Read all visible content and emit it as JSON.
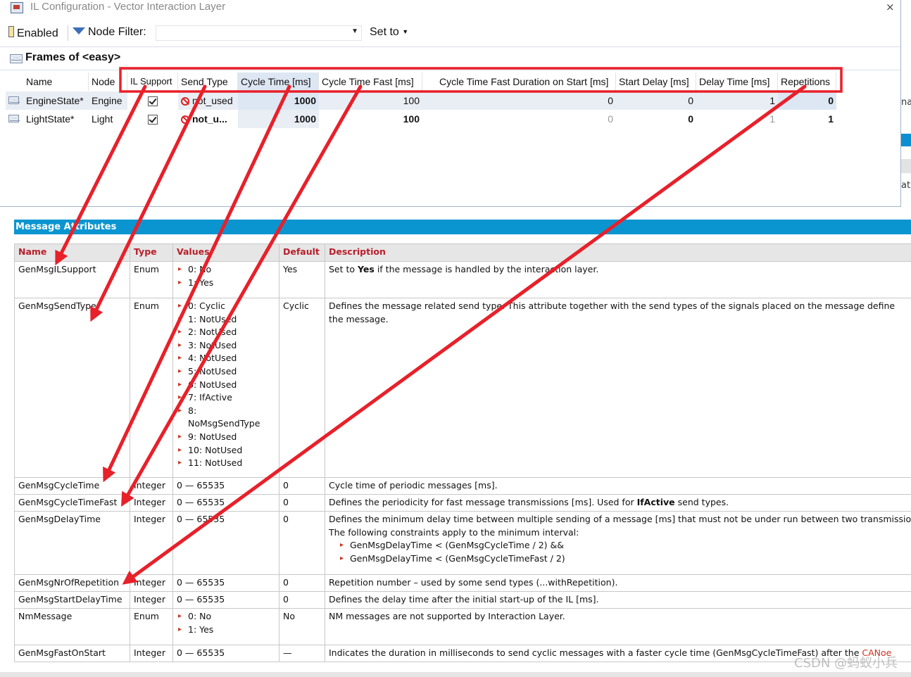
{
  "window": {
    "title": "IL Configuration - Vector Interaction Layer",
    "close_glyph": "×"
  },
  "toolbar": {
    "enabled_label": "Enabled",
    "node_filter_label": "Node Filter:",
    "node_filter_value": "",
    "set_to_label": "Set to"
  },
  "frames": {
    "title": "Frames of <easy>",
    "columns": [
      "Name",
      "Node",
      "IL Support",
      "Send Type",
      "Cycle Time [ms]",
      "Cycle Time Fast [ms]",
      "Cycle Time Fast Duration on Start [ms]",
      "Start Delay [ms]",
      "Delay Time [ms]",
      "Repetitions"
    ],
    "rows": [
      {
        "name": "EngineState*",
        "node": "Engine",
        "il_support": true,
        "send_type": "not_used",
        "cycle_time": "1000",
        "cycle_time_fast": "100",
        "fast_duration": "0",
        "start_delay": "0",
        "delay_time": "1",
        "repetitions": "0"
      },
      {
        "name": "LightState*",
        "node": "Light",
        "il_support": true,
        "send_type": "not_u...",
        "cycle_time": "1000",
        "cycle_time_fast": "100",
        "fast_duration": "0",
        "start_delay": "0",
        "delay_time": "1",
        "repetitions": "1"
      }
    ]
  },
  "right_panel": {
    "text1": "na",
    "text2": "at"
  },
  "attributes": {
    "banner": "Message Attributes",
    "headers": {
      "name": "Name",
      "type": "Type",
      "values": "Values",
      "default": "Default",
      "description": "Description"
    },
    "rows": [
      {
        "name": "GenMsgILSupport",
        "type": "Enum",
        "values": [
          "0: No",
          "1: Yes"
        ],
        "default": "Yes",
        "desc_pre": "Set to ",
        "desc_bold": "Yes",
        "desc_post": " if the message is handled by the interaction layer."
      },
      {
        "name": "GenMsgSendType",
        "type": "Enum",
        "values": [
          "0: Cyclic",
          "1: NotUsed",
          "2: NotUsed",
          "3: NotUsed",
          "4: NotUsed",
          "5: NotUsed",
          "6: NotUsed",
          "7: IfActive",
          "8: NoMsgSendType",
          "9: NotUsed",
          "10: NotUsed",
          "11: NotUsed"
        ],
        "default": "Cyclic",
        "desc": "Defines the message related send type. This attribute together with the send types of the signals placed on the message define the message."
      },
      {
        "name": "GenMsgCycleTime",
        "type": "Integer",
        "range": "0 — 65535",
        "default": "0",
        "desc": "Cycle time of periodic messages [ms]."
      },
      {
        "name": "GenMsgCycleTimeFast",
        "type": "Integer",
        "range": "0 — 65535",
        "default": "0",
        "desc_pre": "Defines the periodicity for fast message transmissions [ms]. Used for ",
        "desc_bold": "IfActive",
        "desc_post": " send types."
      },
      {
        "name": "GenMsgDelayTime",
        "type": "Integer",
        "range": "0 — 65535",
        "default": "0",
        "desc": "Defines the minimum delay time between multiple sending of a message [ms] that must not be under run between two transmissions.",
        "desc2": "The following constraints apply to the minimum interval:",
        "constraints": [
          "GenMsgDelayTime < (GenMsgCycleTime / 2) &&",
          "GenMsgDelayTime < (GenMsgCycleTimeFast / 2)"
        ]
      },
      {
        "name": "GenMsgNrOfRepetition",
        "type": "Integer",
        "range": "0 — 65535",
        "default": "0",
        "desc": "Repetition number – used by some send types (...withRepetition)."
      },
      {
        "name": "GenMsgStartDelayTime",
        "type": "Integer",
        "range": "0 — 65535",
        "default": "0",
        "desc": "Defines the delay time after the initial start-up of the IL [ms]."
      },
      {
        "name": "NmMessage",
        "type": "Enum",
        "values": [
          "0: No",
          "1: Yes"
        ],
        "default": "No",
        "desc": "NM messages are not supported by Interaction Layer."
      },
      {
        "name": "GenMsgFastOnStart",
        "type": "Integer",
        "range": "0 — 65535",
        "default": "—",
        "desc": "Indicates the duration in milliseconds to send cyclic messages with a faster cycle time (GenMsgCycleTimeFast) after the ",
        "desc_red": "CANoe"
      }
    ]
  },
  "watermark": "CSDN @蚂蚁小兵",
  "colors": {
    "accent_blue": "#0b95d0",
    "annotation_red": "#e8202a",
    "header_red": "#b8202b"
  }
}
